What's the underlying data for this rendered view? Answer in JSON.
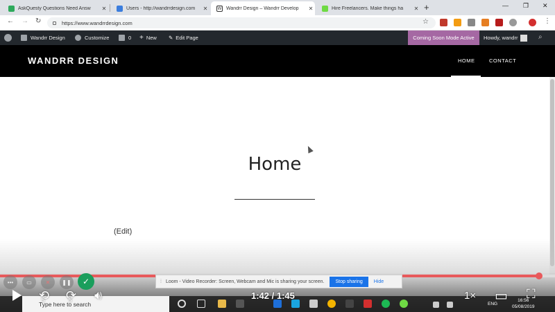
{
  "browser": {
    "tabs": [
      {
        "title": "AskQuesty Questions Need Answ",
        "favicon_color": "#2eaa5c",
        "active": false
      },
      {
        "title": "Users - http://wandrrdesign.com",
        "favicon_color": "#3b7ddd",
        "active": false
      },
      {
        "title": "Wandrr Design – Wandrr Develop",
        "favicon_color": "#ffffff",
        "active": true
      },
      {
        "title": "Hire Freelancers. Make things ha",
        "favicon_color": "#6fda44",
        "active": false
      }
    ],
    "new_tab_glyph": "+",
    "url": "https://www.wandrrdesign.com"
  },
  "wp_admin_bar": {
    "site_name": "Wandrr Design",
    "customize": "Customize",
    "comments_count": "0",
    "new_label": "New",
    "edit_page": "Edit Page",
    "coming_soon": "Coming Soon Mode Active",
    "howdy": "Howdy, wandrr"
  },
  "site": {
    "logo": "WANDRR DESIGN",
    "menu": [
      "HOME",
      "CONTACT"
    ]
  },
  "page": {
    "title": "Home",
    "edit_link": "(Edit)"
  },
  "loom": {
    "sharing_text": "Loom - Video Recorder: Screen, Webcam and Mic is sharing your screen.",
    "stop_sharing": "Stop sharing",
    "hide": "Hide"
  },
  "player": {
    "current_time": "1:42",
    "duration": "1:45",
    "time_display": "1:42 / 1:45",
    "progress_fraction": 0.971,
    "rate": "1×",
    "skip_back_seconds": "5",
    "skip_forward_seconds": "5"
  },
  "taskbar": {
    "search_placeholder": "Type here to search",
    "language": "ENG",
    "time": "16:56",
    "date": "05/08/2019"
  },
  "colors": {
    "accent_progress": "#e8595b",
    "coming_soon_bg": "#a568a3",
    "loom_green": "#1a9e5c"
  }
}
